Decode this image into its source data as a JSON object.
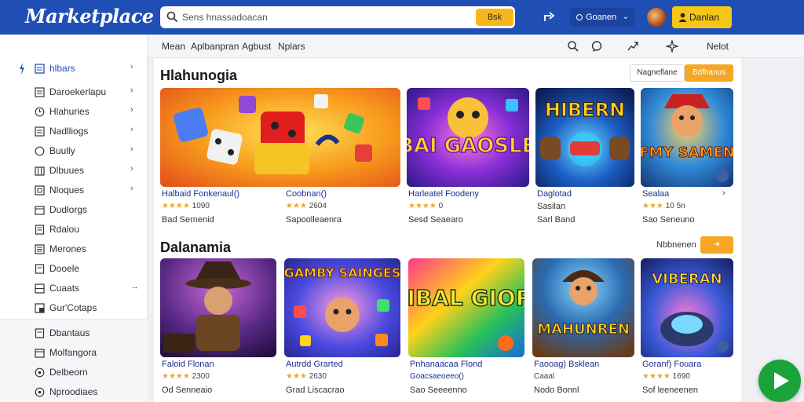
{
  "app": {
    "title": "Marketplace"
  },
  "search": {
    "placeholder": "Sens hnassadoacan",
    "button_label": "Bsk"
  },
  "header": {
    "account_label": "Goanen",
    "signin_label": "Danlan"
  },
  "subnav": {
    "links": [
      "Mean",
      "Aplbanpran",
      "Agbust",
      "Nplars"
    ],
    "more_label": "Nelot"
  },
  "sidebar": {
    "items": [
      {
        "label": "hlbars",
        "icon": "grid-icon"
      },
      {
        "label": "Daroekerlapu",
        "icon": "list-icon"
      },
      {
        "label": "Hlahuries",
        "icon": "clock-icon"
      },
      {
        "label": "Nadlliogs",
        "icon": "list-icon"
      },
      {
        "label": "Buully",
        "icon": "circle-icon"
      },
      {
        "label": "Dlbuues",
        "icon": "building-icon"
      },
      {
        "label": "Nloques",
        "icon": "box-icon"
      },
      {
        "label": "Dudlorgs",
        "icon": "calendar-icon"
      },
      {
        "label": "Rdalou",
        "icon": "doc-icon"
      },
      {
        "label": "Merones",
        "icon": "list-icon"
      },
      {
        "label": "Dooele",
        "icon": "doc-icon"
      },
      {
        "label": "Cuaats",
        "icon": "box-icon"
      },
      {
        "label": "Gur'Cotaps",
        "icon": "box-icon"
      }
    ],
    "lower_items": [
      {
        "label": "Dbantaus",
        "icon": "doc-icon"
      },
      {
        "label": "Molfangora",
        "icon": "calendar-icon"
      },
      {
        "label": "Delbeorn",
        "icon": "circle-icon"
      },
      {
        "label": "Nproodiaes",
        "icon": "circle-icon"
      }
    ]
  },
  "sections": [
    {
      "title": "Hlahunogia",
      "buttons": [
        "Nagneflane",
        "Bdfhanus"
      ],
      "cards": [
        {
          "title": "Halbaid Fonkenaul()",
          "rating": "1090",
          "price": "Bad Sernenid"
        },
        {
          "title": "Coobnan()",
          "rating": "2604",
          "price": "Sapoolleaenra"
        },
        {
          "title": "Harleatel Foodeny",
          "rating": "0",
          "price": "Sesd Seaearo"
        },
        {
          "title": "Daglotad",
          "rating": "",
          "price": "Sarl Band"
        },
        {
          "title": "Sealaa",
          "rating": "10 5n",
          "price": "Sao Seneuno"
        }
      ],
      "art_texts": [
        "",
        "MBAI GAOSLEIS",
        "HIBERN",
        "SAFMY SAMENRS"
      ]
    },
    {
      "title": "Dalanamia",
      "more_label": "Nbbnenen",
      "cards": [
        {
          "title": "Faloid Flonan",
          "rating": "2300",
          "price": "Od Senneaio"
        },
        {
          "title": "Autrdd Grarted",
          "rating": "2630",
          "price": "Grad Liscacrao"
        },
        {
          "title": "Pnhanaacaa Flond",
          "rating": "",
          "price": "Goacsaeoeeo()"
        },
        {
          "title": "Faooag) Bsklean",
          "rating": "",
          "price": "Caaal"
        },
        {
          "title": "Goranf) Fouara",
          "rating": "1690",
          "price": "Sof leeneenen"
        }
      ],
      "art_texts": [
        "",
        "GAMBY SAINGES",
        "MIBAL GIORE",
        "MAHUNREN",
        "VIBERAN"
      ],
      "extra_prices": [
        "",
        "",
        "Sao Seeeenno",
        "Nodo Bonnl",
        ""
      ]
    }
  ],
  "colors": {
    "brand": "#1f4fb5",
    "accent": "#f5a623",
    "play": "#1aa33a"
  }
}
